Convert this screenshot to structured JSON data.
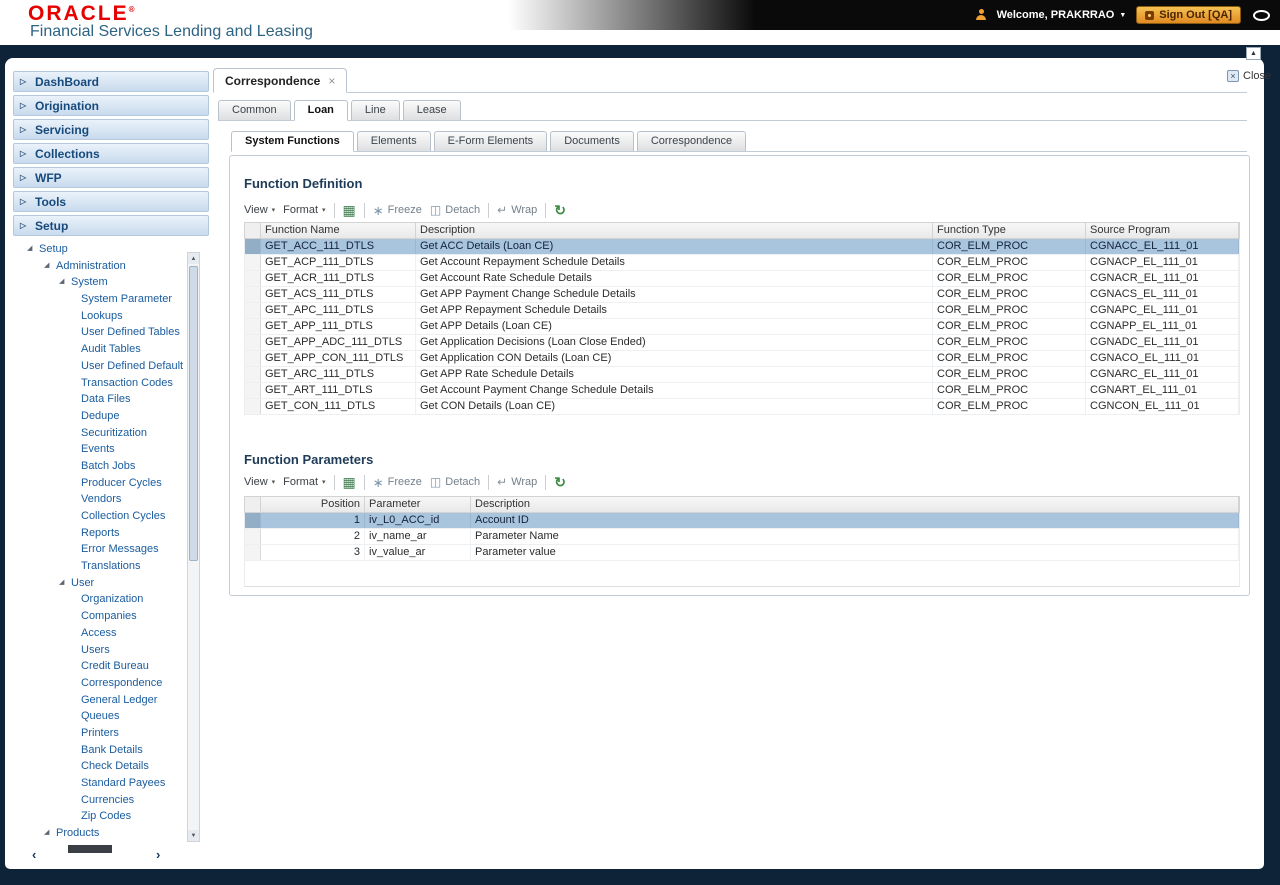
{
  "theme": {
    "oracle_red": "#e60000",
    "title_blue": "#2d6383",
    "accent_navy": "#174a7c",
    "section_navy": "#1f3b57",
    "link_blue": "#1a5c9e",
    "selected_row": "#a9c4dd",
    "signout_gold": "#f6c253",
    "frame_navy": "#0e2238"
  },
  "icons": {
    "disclosure": "▷",
    "tree_expanded": "◢",
    "caret_down": "▼",
    "menu_caret": "▾",
    "tab_close": "×",
    "close_x": "×",
    "export": "▦",
    "freeze": "∗",
    "detach": "◫",
    "wrap": "↵",
    "refresh": "↻",
    "scroll_up": "▲",
    "scroll_down": "▼",
    "scroll_left": "‹",
    "scroll_right": "›"
  },
  "header": {
    "logo_text": "ORACLE",
    "logo_registered": "®",
    "subtitle": "Financial Services Lending and Leasing",
    "welcome_label": "Welcome, PRAKRRAO",
    "sign_out_label": "Sign Out [QA]"
  },
  "sidebar": {
    "accordion_items": [
      "DashBoard",
      "Origination",
      "Servicing",
      "Collections",
      "WFP",
      "Tools"
    ],
    "setup_section_label": "Setup",
    "tree": [
      {
        "label": "Setup",
        "type": "branch",
        "indent": 0
      },
      {
        "label": "Administration",
        "type": "branch",
        "indent": 1
      },
      {
        "label": "System",
        "type": "branch",
        "indent": 2
      },
      {
        "label": "System Parameter",
        "type": "leaf",
        "indent": 3
      },
      {
        "label": "Lookups",
        "type": "leaf",
        "indent": 3
      },
      {
        "label": "User Defined Tables",
        "type": "leaf",
        "indent": 3
      },
      {
        "label": "Audit Tables",
        "type": "leaf",
        "indent": 3
      },
      {
        "label": "User Defined Default",
        "type": "leaf",
        "indent": 3
      },
      {
        "label": "Transaction Codes",
        "type": "leaf",
        "indent": 3
      },
      {
        "label": "Data Files",
        "type": "leaf",
        "indent": 3
      },
      {
        "label": "Dedupe",
        "type": "leaf",
        "indent": 3
      },
      {
        "label": "Securitization",
        "type": "leaf",
        "indent": 3
      },
      {
        "label": "Events",
        "type": "leaf",
        "indent": 3
      },
      {
        "label": "Batch Jobs",
        "type": "leaf",
        "indent": 3
      },
      {
        "label": "Producer Cycles",
        "type": "leaf",
        "indent": 3
      },
      {
        "label": "Vendors",
        "type": "leaf",
        "indent": 3
      },
      {
        "label": "Collection Cycles",
        "type": "leaf",
        "indent": 3
      },
      {
        "label": "Reports",
        "type": "leaf",
        "indent": 3
      },
      {
        "label": "Error Messages",
        "type": "leaf",
        "indent": 3
      },
      {
        "label": "Translations",
        "type": "leaf",
        "indent": 3
      },
      {
        "label": "User",
        "type": "branch",
        "indent": 2
      },
      {
        "label": "Organization",
        "type": "leaf",
        "indent": 3
      },
      {
        "label": "Companies",
        "type": "leaf",
        "indent": 3
      },
      {
        "label": "Access",
        "type": "leaf",
        "indent": 3
      },
      {
        "label": "Users",
        "type": "leaf",
        "indent": 3
      },
      {
        "label": "Credit Bureau",
        "type": "leaf",
        "indent": 3
      },
      {
        "label": "Correspondence",
        "type": "leaf",
        "indent": 3
      },
      {
        "label": "General Ledger",
        "type": "leaf",
        "indent": 3
      },
      {
        "label": "Queues",
        "type": "leaf",
        "indent": 3
      },
      {
        "label": "Printers",
        "type": "leaf",
        "indent": 3
      },
      {
        "label": "Bank Details",
        "type": "leaf",
        "indent": 3
      },
      {
        "label": "Check Details",
        "type": "leaf",
        "indent": 3
      },
      {
        "label": "Standard Payees",
        "type": "leaf",
        "indent": 3
      },
      {
        "label": "Currencies",
        "type": "leaf",
        "indent": 3
      },
      {
        "label": "Zip Codes",
        "type": "leaf",
        "indent": 3
      },
      {
        "label": "Products",
        "type": "branch",
        "indent": 1
      }
    ]
  },
  "toolbar": {
    "view_label": "View",
    "format_label": "Format",
    "freeze_label": "Freeze",
    "detach_label": "Detach",
    "wrap_label": "Wrap"
  },
  "main": {
    "doc_tab": {
      "label": "Correspondence"
    },
    "close_label": "Close",
    "module_tabs": [
      {
        "label": "Common"
      },
      {
        "label": "Loan",
        "active": true
      },
      {
        "label": "Line"
      },
      {
        "label": "Lease"
      }
    ],
    "sub_tabs": [
      {
        "label": "System Functions",
        "active": true
      },
      {
        "label": "Elements"
      },
      {
        "label": "E-Form Elements"
      },
      {
        "label": "Documents"
      },
      {
        "label": "Correspondence"
      }
    ],
    "function_definition": {
      "title": "Function Definition",
      "columns": [
        "Function Name",
        "Description",
        "Function Type",
        "Source Program"
      ],
      "selected_row": 0,
      "rows": [
        [
          "GET_ACC_111_DTLS",
          "Get ACC Details (Loan CE)",
          "COR_ELM_PROC",
          "CGNACC_EL_111_01"
        ],
        [
          "GET_ACP_111_DTLS",
          "Get Account Repayment Schedule Details",
          "COR_ELM_PROC",
          "CGNACP_EL_111_01"
        ],
        [
          "GET_ACR_111_DTLS",
          "Get Account Rate Schedule Details",
          "COR_ELM_PROC",
          "CGNACR_EL_111_01"
        ],
        [
          "GET_ACS_111_DTLS",
          "Get APP Payment Change Schedule Details",
          "COR_ELM_PROC",
          "CGNACS_EL_111_01"
        ],
        [
          "GET_APC_111_DTLS",
          "Get APP Repayment Schedule Details",
          "COR_ELM_PROC",
          "CGNAPC_EL_111_01"
        ],
        [
          "GET_APP_111_DTLS",
          "Get APP Details (Loan CE)",
          "COR_ELM_PROC",
          "CGNAPP_EL_111_01"
        ],
        [
          "GET_APP_ADC_111_DTLS",
          "Get Application Decisions (Loan Close Ended)",
          "COR_ELM_PROC",
          "CGNADC_EL_111_01"
        ],
        [
          "GET_APP_CON_111_DTLS",
          "Get Application CON Details (Loan CE)",
          "COR_ELM_PROC",
          "CGNACO_EL_111_01"
        ],
        [
          "GET_ARC_111_DTLS",
          "Get APP Rate Schedule Details",
          "COR_ELM_PROC",
          "CGNARC_EL_111_01"
        ],
        [
          "GET_ART_111_DTLS",
          "Get Account Payment Change Schedule Details",
          "COR_ELM_PROC",
          "CGNART_EL_111_01"
        ],
        [
          "GET_CON_111_DTLS",
          "Get CON Details (Loan CE)",
          "COR_ELM_PROC",
          "CGNCON_EL_111_01"
        ]
      ]
    },
    "function_parameters": {
      "title": "Function Parameters",
      "columns": [
        "Position",
        "Parameter",
        "Description"
      ],
      "selected_row": 0,
      "rows": [
        [
          "1",
          "iv_L0_ACC_id",
          "Account ID"
        ],
        [
          "2",
          "iv_name_ar",
          "Parameter Name"
        ],
        [
          "3",
          "iv_value_ar",
          "Parameter value"
        ]
      ]
    }
  }
}
